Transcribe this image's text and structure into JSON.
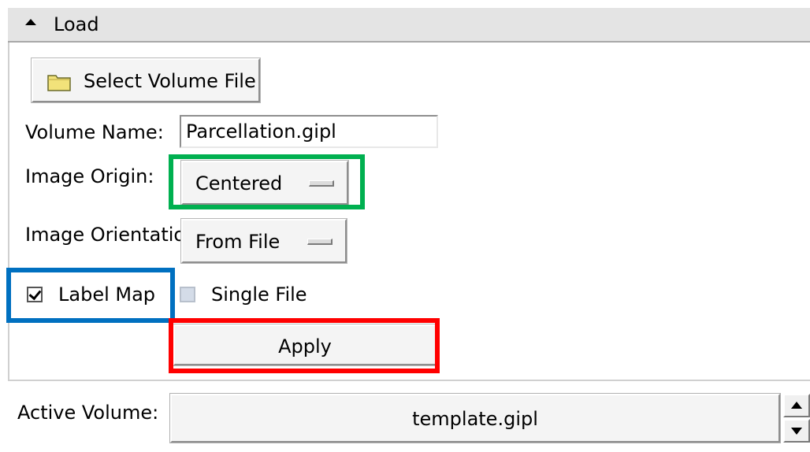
{
  "section": {
    "title": "Load",
    "collapse_icon": "triangle-up-icon"
  },
  "load": {
    "select_file_label": "Select Volume File",
    "select_file_icon": "folder-icon",
    "volume_name_label": "Volume Name:",
    "volume_name_value": "Parcellation.gipl",
    "image_origin_label": "Image Origin:",
    "image_origin_value": "Centered",
    "image_orientation_label": "Image Orientatio",
    "image_orientation_value": "From File",
    "label_map_label": "Label Map",
    "label_map_checked": true,
    "single_file_label": "Single File",
    "single_file_checked": false,
    "apply_label": "Apply"
  },
  "active_volume": {
    "label": "Active Volume:",
    "value": "template.gipl"
  },
  "highlights": {
    "green": "#00b050",
    "blue": "#0070c0",
    "red": "#ff0000"
  }
}
